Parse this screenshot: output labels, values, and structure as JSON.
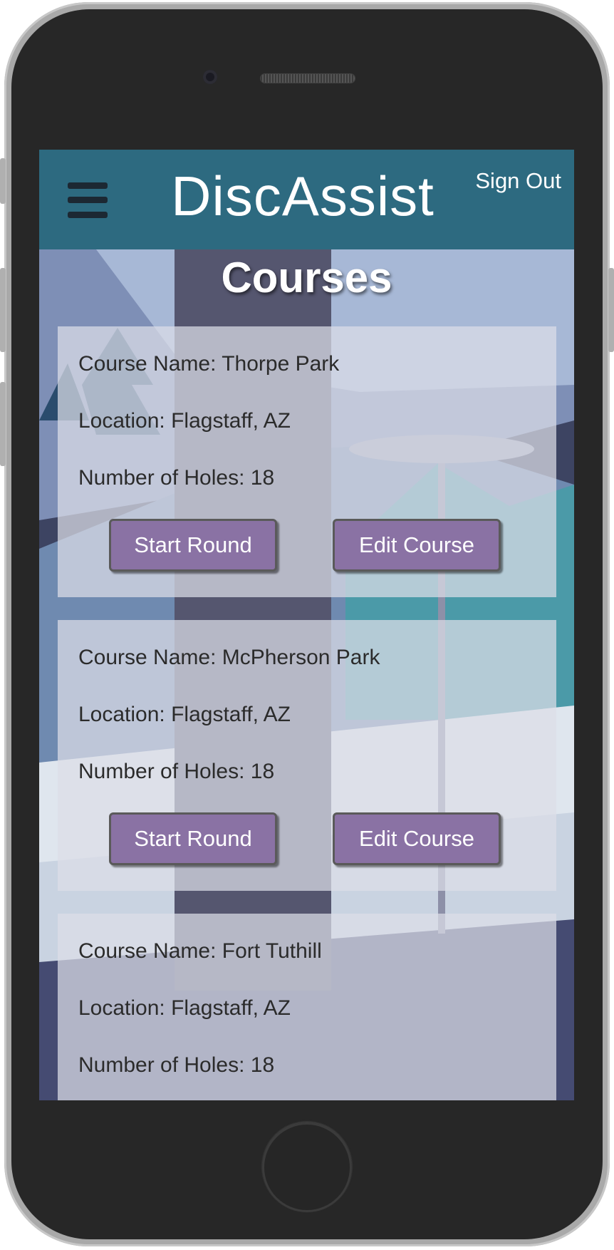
{
  "app": {
    "brand": "DiscAssist",
    "sign_out_label": "Sign Out",
    "menu_icon": "hamburger-menu-icon"
  },
  "page": {
    "title": "Courses"
  },
  "courses": [
    {
      "name_line": "Course Name: Thorpe Park",
      "location_line": "Location: Flagstaff, AZ",
      "holes_line": "Number of Holes: 18",
      "start_label": "Start Round",
      "edit_label": "Edit Course"
    },
    {
      "name_line": "Course Name: McPherson Park",
      "location_line": "Location: Flagstaff, AZ",
      "holes_line": "Number of Holes: 18",
      "start_label": "Start Round",
      "edit_label": "Edit Course"
    },
    {
      "name_line": "Course Name: Fort Tuthill",
      "location_line": "Location: Flagstaff, AZ",
      "holes_line": "Number of Holes: 18"
    }
  ],
  "colors": {
    "header": "#2d6a80",
    "button": "#8a72a4",
    "card": "#dcdee8"
  }
}
